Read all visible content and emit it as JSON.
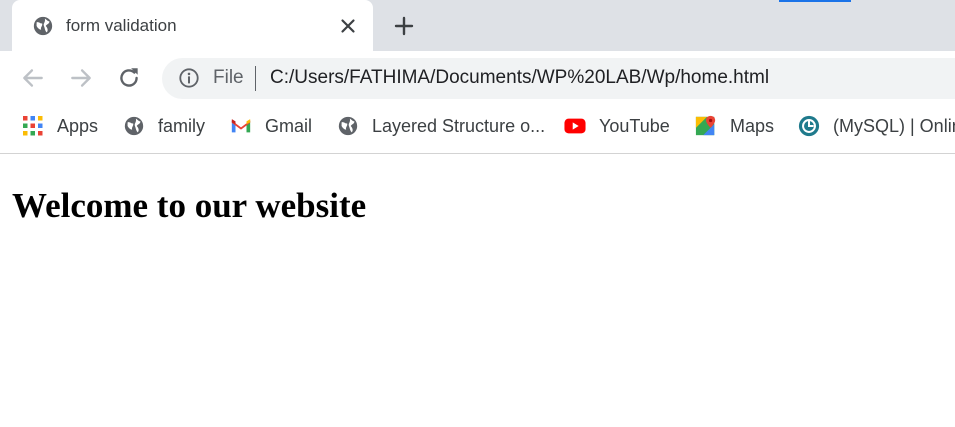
{
  "browser": {
    "tab": {
      "title": "form validation",
      "icon": "globe-icon",
      "close_icon": "close-icon"
    },
    "new_tab_icon": "plus-icon",
    "nav": {
      "back_icon": "arrow-left-icon",
      "forward_icon": "arrow-right-icon",
      "reload_icon": "reload-icon"
    },
    "omnibox": {
      "info_icon": "info-icon",
      "scheme": "File",
      "url": "C:/Users/FATHIMA/Documents/WP%20LAB/Wp/home.html"
    },
    "bookmarks": [
      {
        "label": "Apps",
        "icon": "apps-grid-icon"
      },
      {
        "label": "family",
        "icon": "globe-icon"
      },
      {
        "label": "Gmail",
        "icon": "gmail-icon"
      },
      {
        "label": "Layered Structure o...",
        "icon": "globe-icon"
      },
      {
        "label": "YouTube",
        "icon": "youtube-icon"
      },
      {
        "label": "Maps",
        "icon": "maps-icon"
      },
      {
        "label": "(MySQL) | Onlin",
        "icon": "mysql-icon"
      }
    ],
    "colors": {
      "tabstrip": "#dee1e6",
      "accent": "#1a73e8",
      "omnibox": "#f1f3f4"
    }
  },
  "page": {
    "heading": "Welcome to our website"
  }
}
